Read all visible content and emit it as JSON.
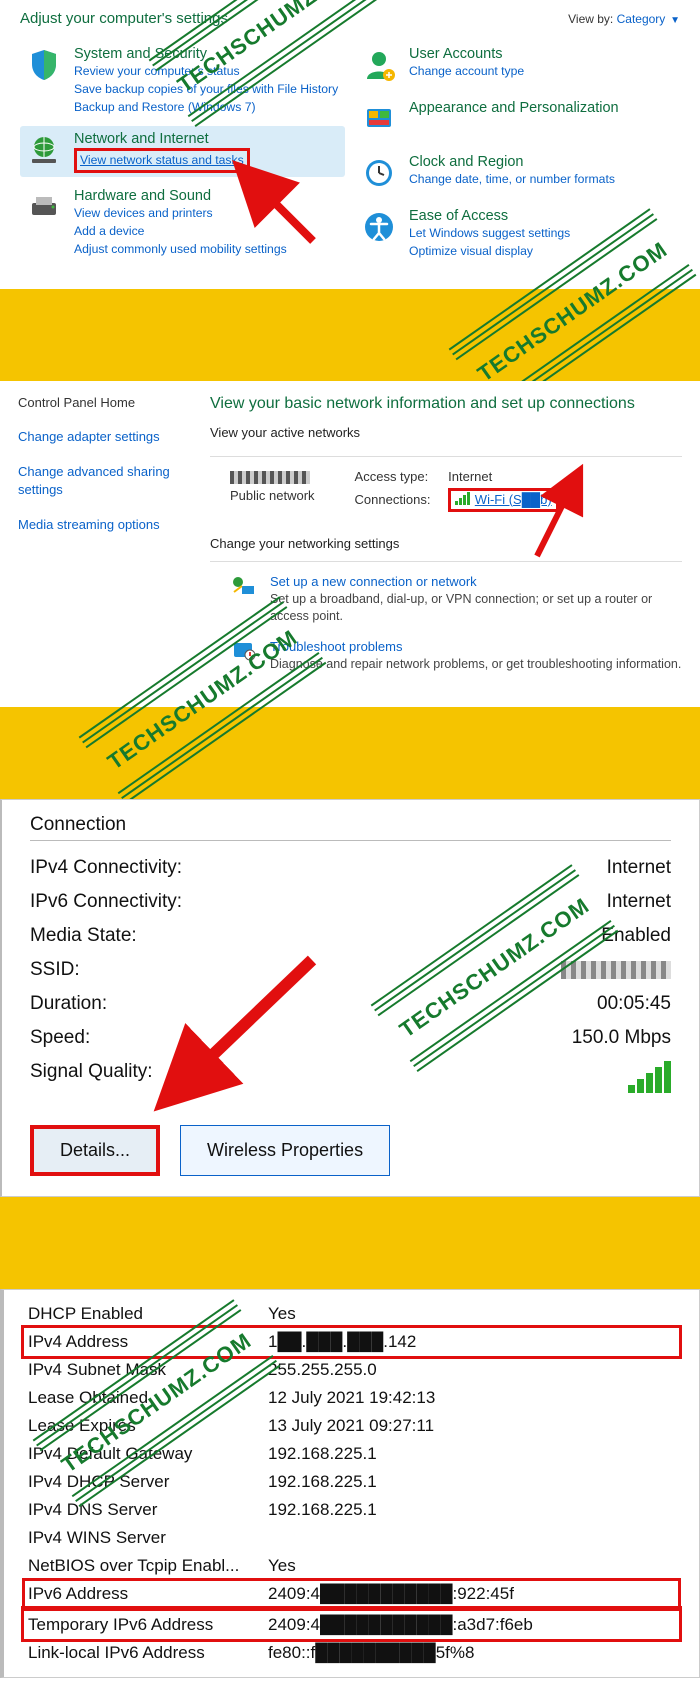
{
  "panel1": {
    "title": "Adjust your computer's settings",
    "viewby_label": "View by:",
    "viewby_value": "Category",
    "left": [
      {
        "head": "System and Security",
        "links": [
          "Review your computer's status",
          "Save backup copies of your files with File History",
          "Backup and Restore (Windows 7)"
        ]
      },
      {
        "head": "Network and Internet",
        "links": [
          "View network status and tasks"
        ],
        "highlighted": true
      },
      {
        "head": "Hardware and Sound",
        "links": [
          "View devices and printers",
          "Add a device",
          "Adjust commonly used mobility settings"
        ]
      }
    ],
    "right": [
      {
        "head": "User Accounts",
        "links": [
          "Change account type"
        ]
      },
      {
        "head": "Appearance and Personalization",
        "links": []
      },
      {
        "head": "Clock and Region",
        "links": [
          "Change date, time, or number formats"
        ]
      },
      {
        "head": "Ease of Access",
        "links": [
          "Let Windows suggest settings",
          "Optimize visual display"
        ]
      }
    ]
  },
  "panel2": {
    "side": {
      "home": "Control Panel Home",
      "links": [
        "Change adapter settings",
        "Change advanced sharing settings",
        "Media streaming options"
      ]
    },
    "title": "View your basic network information and set up connections",
    "active_label": "View your active networks",
    "network": {
      "type": "Public network"
    },
    "access": {
      "type_label": "Access type:",
      "type_value": "Internet",
      "conn_label": "Connections:",
      "wifi_text": "Wi-Fi (S██b)"
    },
    "change_label": "Change your networking settings",
    "opts": [
      {
        "head": "Set up a new connection or network",
        "desc": "Set up a broadband, dial-up, or VPN connection; or set up a router or access point."
      },
      {
        "head": "Troubleshoot problems",
        "desc": "Diagnose and repair network problems, or get troubleshooting information."
      }
    ]
  },
  "panel3": {
    "section": "Connection",
    "rows": [
      {
        "l": "IPv4 Connectivity:",
        "v": "Internet"
      },
      {
        "l": "IPv6 Connectivity:",
        "v": "Internet"
      },
      {
        "l": "Media State:",
        "v": "Enabled"
      },
      {
        "l": "SSID:",
        "v": ""
      },
      {
        "l": "Duration:",
        "v": "00:05:45"
      },
      {
        "l": "Speed:",
        "v": "150.0 Mbps"
      },
      {
        "l": "Signal Quality:",
        "v": ""
      }
    ],
    "btn_details": "Details...",
    "btn_wireless": "Wireless Properties"
  },
  "panel4": {
    "rows": [
      {
        "l": "DHCP Enabled",
        "v": "Yes"
      },
      {
        "l": "IPv4 Address",
        "v": "1██.███.███.142",
        "box": "top"
      },
      {
        "l": "IPv4 Subnet Mask",
        "v": "255.255.255.0"
      },
      {
        "l": "Lease Obtained",
        "v": "12 July 2021 19:42:13"
      },
      {
        "l": "Lease Expires",
        "v": "13 July 2021 09:27:11"
      },
      {
        "l": "IPv4 Default Gateway",
        "v": "192.168.225.1"
      },
      {
        "l": "IPv4 DHCP Server",
        "v": "192.168.225.1"
      },
      {
        "l": "IPv4 DNS Server",
        "v": "192.168.225.1"
      },
      {
        "l": "IPv4 WINS Server",
        "v": ""
      },
      {
        "l": "NetBIOS over Tcpip Enabl...",
        "v": "Yes"
      },
      {
        "l": "IPv6 Address",
        "v": "2409:4███████████:922:45f",
        "box": "top2"
      },
      {
        "l": "Temporary IPv6 Address",
        "v": "2409:4███████████:a3d7:f6eb",
        "box": "bot2"
      },
      {
        "l": "Link-local IPv6 Address",
        "v": "fe80::f██████████5f%8"
      }
    ]
  },
  "watermark": "TECHSCHUMZ.COM"
}
